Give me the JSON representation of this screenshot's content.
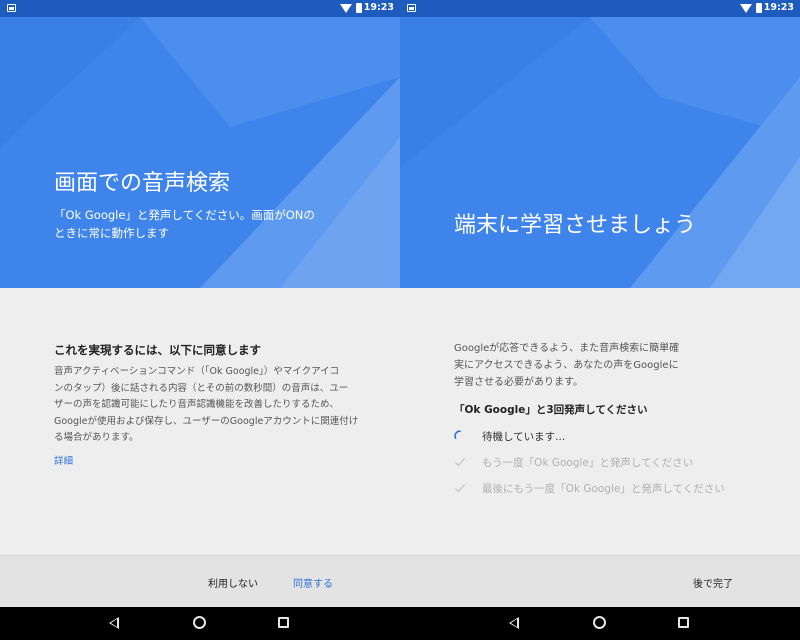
{
  "colors": {
    "status_bar": "#1e5bbf",
    "hero_blue": "#3f84ea",
    "hero_light": "#6ea3f1",
    "hero_dark": "#2f74dc",
    "content_bg": "#eeeeee",
    "button_bar": "#e3e3e3",
    "accent_link": "#2a73d8",
    "nav_bar": "#000000"
  },
  "status_bar": {
    "time": "19:23"
  },
  "left": {
    "hero": {
      "title": "画面での音声検索",
      "subtitle_line1": "「Ok Google」と発声してください。画面がONの",
      "subtitle_line2": "ときに常に動作します"
    },
    "heading": "これを実現するには、以下に同意します",
    "paragraph": [
      "音声アクティベーションコマンド（「Ok Google」）やマイクアイコ",
      "ンのタップ）後に話される内容（とその前の数秒間）の音声は、ユー",
      "ザーの声を認識可能にしたり音声認識機能を改善したりするため、",
      "Googleが使用および保存し、ユーザーのGoogleアカウントに関連付け",
      "る場合があります。"
    ],
    "details_link": "詳細",
    "buttons": {
      "decline": "利用しない",
      "accept": "同意する"
    }
  },
  "right": {
    "hero": {
      "title": "端末に学習させましょう"
    },
    "paragraph": [
      "Googleが応答できるよう、また音声検索に簡単確",
      "実にアクセスできるよう、あなたの声をGoogleに",
      "学習させる必要があります。"
    ],
    "instruction": "「Ok Google」と3回発声してください",
    "steps": [
      {
        "label": "待機しています...",
        "icon": "spinner-icon",
        "state": "active"
      },
      {
        "label": "もう一度「Ok Google」と発声してください",
        "icon": "checkmark-icon",
        "state": "pending"
      },
      {
        "label": "最後にもう一度「Ok Google」と発声してください",
        "icon": "checkmark-icon",
        "state": "pending"
      }
    ],
    "buttons": {
      "later": "後で完了"
    }
  },
  "nav_bar": {
    "icons": [
      "back-icon",
      "home-icon",
      "recents-icon"
    ]
  }
}
